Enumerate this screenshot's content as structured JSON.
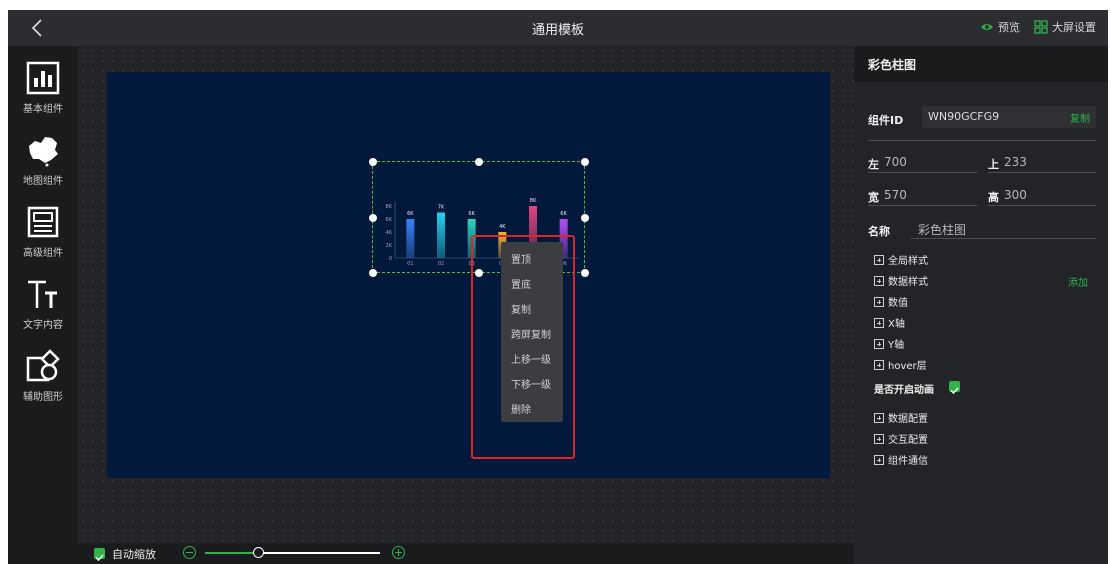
{
  "header": {
    "title": "通用模板",
    "preview_label": "预览",
    "screen_settings_label": "大屏设置"
  },
  "sidebar": {
    "items": [
      {
        "label": "基本组件",
        "icon": "bar-chart-icon"
      },
      {
        "label": "地图组件",
        "icon": "china-map-icon"
      },
      {
        "label": "高级组件",
        "icon": "layout-icon"
      },
      {
        "label": "文字内容",
        "icon": "text-icon"
      },
      {
        "label": "辅助图形",
        "icon": "shapes-icon"
      }
    ]
  },
  "chart_data": {
    "type": "bar",
    "categories": [
      "01",
      "02",
      "03",
      "04",
      "05",
      "06"
    ],
    "values": [
      6,
      7,
      6,
      4,
      8,
      6
    ],
    "value_labels": [
      "6K",
      "7K",
      "6K",
      "4K",
      "8K",
      "6K"
    ],
    "y_ticks": [
      "0",
      "2K",
      "4K",
      "6K",
      "8K"
    ],
    "ylim": [
      0,
      8
    ],
    "colors": [
      "#3b82f6",
      "#22d3ee",
      "#2dd4bf",
      "#f5b82e",
      "#e0457b",
      "#b44cf0"
    ],
    "grid": false
  },
  "context_menu": {
    "items": [
      "置顶",
      "置底",
      "复制",
      "跨屏复制",
      "上移一级",
      "下移一级",
      "删除"
    ]
  },
  "bottombar": {
    "auto_zoom_label": "自动缩放",
    "zoom_fraction": 0.3
  },
  "panel": {
    "title": "彩色柱图",
    "component_id_label": "组件ID",
    "component_id": "WN90GCFG9",
    "copy_label": "复制",
    "left_label": "左",
    "left_value": "700",
    "top_label": "上",
    "top_value": "233",
    "width_label": "宽",
    "width_value": "570",
    "height_label": "高",
    "height_value": "300",
    "name_label": "名称",
    "name_value": "彩色柱图",
    "tree": {
      "global_style": "全局样式",
      "data_style": "数据样式",
      "add_label": "添加",
      "numeric": "数值",
      "x_axis": "X轴",
      "y_axis": "Y轴",
      "hover_layer": "hover层"
    },
    "animation_label": "是否开启动画",
    "animation_enabled": true,
    "tree2": {
      "data_config": "数据配置",
      "interaction_config": "交互配置",
      "component_comm": "组件通信"
    }
  },
  "colors": {
    "accent": "#2fb34a",
    "screen_bg": "#03193c",
    "highlight": "#e02424"
  }
}
